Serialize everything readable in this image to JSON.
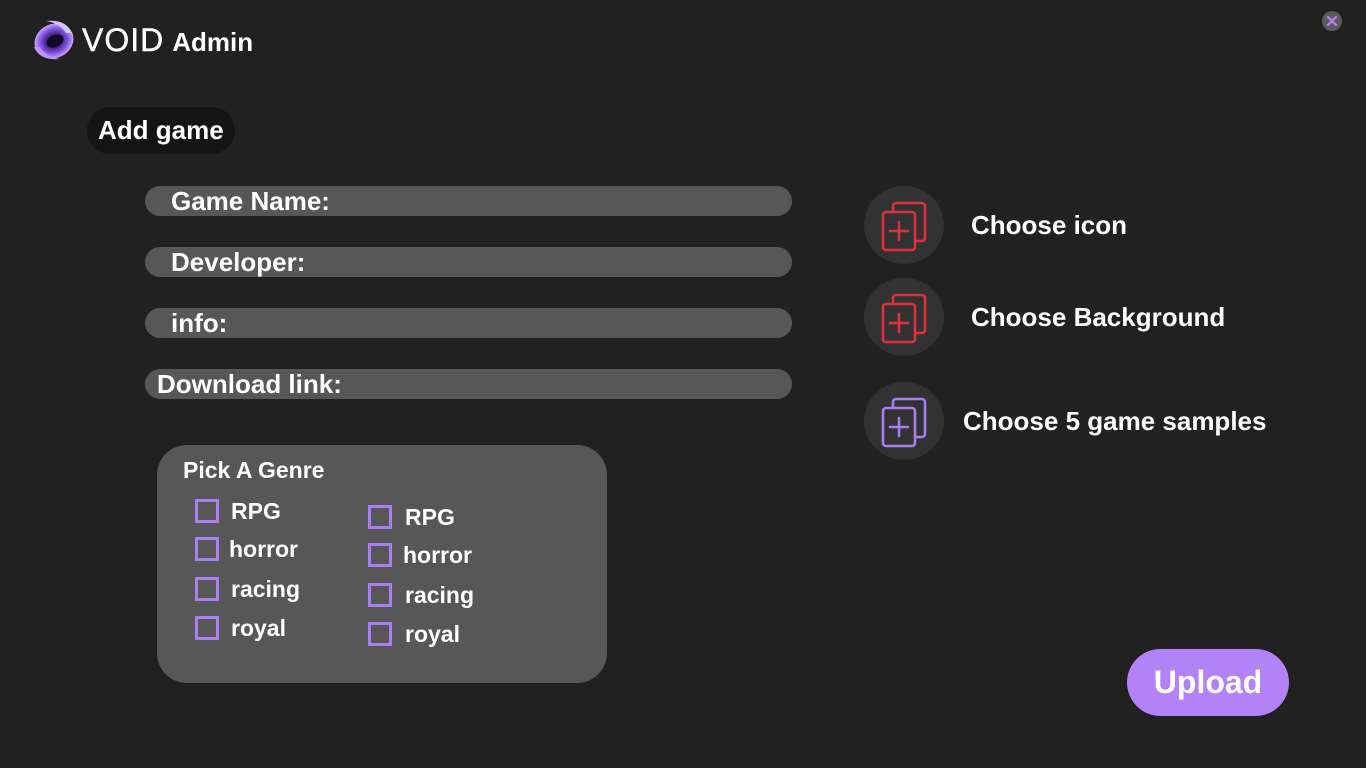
{
  "header": {
    "logo_text": "VOID",
    "title": "Admin",
    "logo_icon": "void-swirl-logo",
    "close_icon": "close-icon"
  },
  "form": {
    "section_title": "Add game",
    "fields": [
      {
        "label": "Game Name:",
        "value": ""
      },
      {
        "label": "Developer:",
        "value": ""
      },
      {
        "label": "info:",
        "value": ""
      },
      {
        "label": "Download link:",
        "value": ""
      }
    ]
  },
  "genres": {
    "title": "Pick A Genre",
    "columns": [
      [
        {
          "label": "RPG",
          "checked": false
        },
        {
          "label": "horror",
          "checked": false
        },
        {
          "label": "racing",
          "checked": false
        },
        {
          "label": "royal",
          "checked": false
        }
      ],
      [
        {
          "label": "RPG",
          "checked": false
        },
        {
          "label": "horror",
          "checked": false
        },
        {
          "label": "racing",
          "checked": false
        },
        {
          "label": "royal",
          "checked": false
        }
      ]
    ]
  },
  "media": [
    {
      "label": "Choose icon",
      "icon": "add-file-icon",
      "color": "#e0303f"
    },
    {
      "label": "Choose Background",
      "icon": "add-file-icon",
      "color": "#e0303f"
    },
    {
      "label": "Choose 5 game samples",
      "icon": "add-file-icon",
      "color": "#a87ef0"
    }
  ],
  "actions": {
    "upload_label": "Upload"
  },
  "colors": {
    "background": "#212121",
    "panel": "#575757",
    "accent": "#b382f7",
    "checkbox": "#a87ef0",
    "danger": "#e0303f"
  }
}
